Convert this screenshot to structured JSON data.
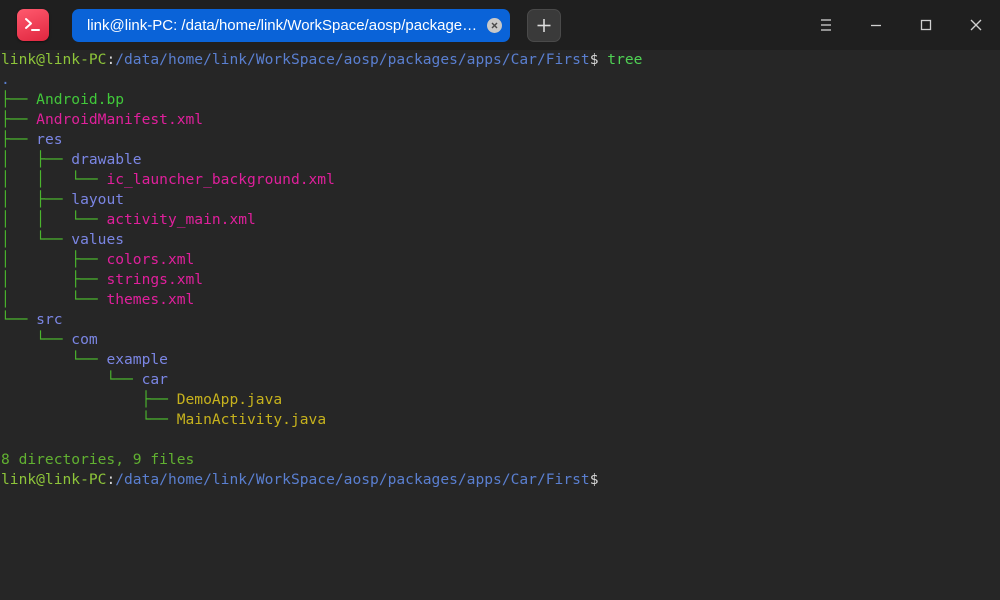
{
  "app": {
    "icon": "terminal-icon",
    "accent": "#0a63d8"
  },
  "tab": {
    "title": "link@link-PC: /data/home/link/WorkSpace/aosp/packages/a…",
    "close_icon": "close-icon"
  },
  "toolbar": {
    "new_tab_icon": "plus-icon",
    "menu_icon": "menu-icon",
    "minimize_icon": "minimize-icon",
    "maximize_icon": "maximize-icon",
    "close_icon": "close-icon"
  },
  "terminal": {
    "prompt_user": "link@link-PC",
    "prompt_sep": ":",
    "prompt_path": "/data/home/link/WorkSpace/aosp/packages/apps/Car/First",
    "prompt_symbol": "$",
    "command": " tree",
    "root": ".",
    "entries": [
      {
        "prefix": "├── ",
        "name": "Android.bp"
      },
      {
        "prefix": "├── ",
        "name": "AndroidManifest.xml"
      },
      {
        "prefix": "├── ",
        "name": "res"
      },
      {
        "prefix": "│   ├── ",
        "name": "drawable"
      },
      {
        "prefix": "│   │   └── ",
        "name": "ic_launcher_background.xml"
      },
      {
        "prefix": "│   ├── ",
        "name": "layout"
      },
      {
        "prefix": "│   │   └── ",
        "name": "activity_main.xml"
      },
      {
        "prefix": "│   └── ",
        "name": "values"
      },
      {
        "prefix": "│       ├── ",
        "name": "colors.xml"
      },
      {
        "prefix": "│       ├── ",
        "name": "strings.xml"
      },
      {
        "prefix": "│       └── ",
        "name": "themes.xml"
      },
      {
        "prefix": "└── ",
        "name": "src"
      },
      {
        "prefix": "    └── ",
        "name": "com"
      },
      {
        "prefix": "        └── ",
        "name": "example"
      },
      {
        "prefix": "            └── ",
        "name": "car"
      },
      {
        "prefix": "                ├── ",
        "name": "DemoApp.java"
      },
      {
        "prefix": "                └── ",
        "name": "MainActivity.java"
      }
    ],
    "summary": "8 directories, 9 files",
    "colors": {
      "user": "#8ec53a",
      "path": "#5a7fd0",
      "directory": "#7b86e4",
      "xml": "#e01f9c",
      "java": "#c6b21d",
      "build_file": "#40c93a"
    }
  }
}
